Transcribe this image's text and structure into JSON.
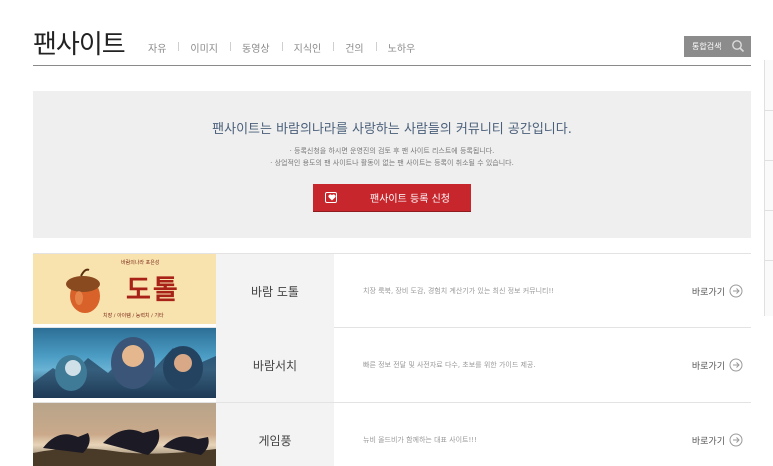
{
  "header": {
    "title": "팬사이트",
    "nav": [
      "자유",
      "이미지",
      "동영상",
      "지식인",
      "건의",
      "노하우"
    ],
    "search_label": "통합검색",
    "search_icon": "search-icon"
  },
  "intro": {
    "headline": "팬사이트는 바람의나라를 사랑하는 사람들의 커뮤니티 공간입니다.",
    "note_1": "· 등록신청을 하시면 운영진의 검토 후 팬 사이트 리스트에 등록됩니다.",
    "note_2": "· 상업적인 용도의 팬 사이트나 활동이 없는 팬 사이트는 등록이 취소될 수 있습니다.",
    "register_label": "팬사이트 등록 신청",
    "register_icon": "heart-card-icon",
    "accent": "#c6262c"
  },
  "sites": [
    {
      "name": "바람 도톨",
      "desc": "치장 룩북, 장비 도감, 경험치 계산기가 있는 최신 정보 커뮤니티!!",
      "go": "바로가기",
      "logo_top": "바람의나라 포은성",
      "logo_main": "도톨",
      "logo_sub": "치장 / 아이템 / 능력치 / 기타"
    },
    {
      "name": "바람서치",
      "desc": "빠른 정보 전달 및 사전자료 다수, 초보를 위한 가이드 제공.",
      "go": "바로가기"
    },
    {
      "name": "게임풍",
      "desc": "뉴비 올드비가 함께하는 대표 사이트!!!",
      "go": "바로가기"
    }
  ]
}
